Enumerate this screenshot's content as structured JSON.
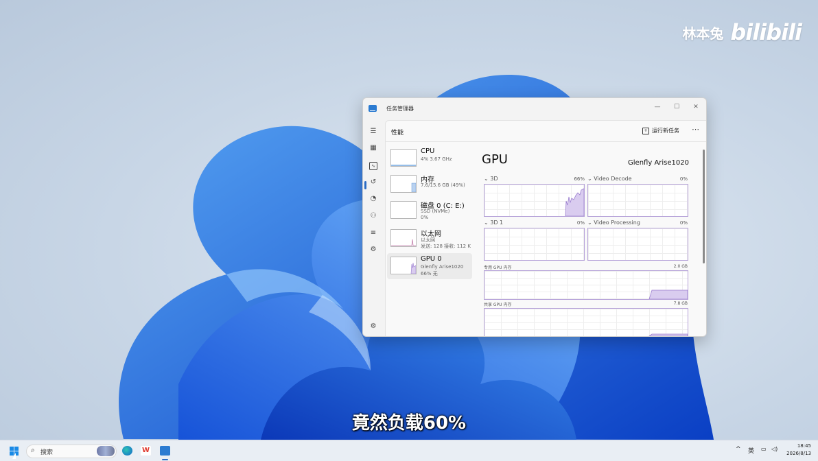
{
  "watermark": {
    "author": "林本兔",
    "brand": "bilibili"
  },
  "subtitle": "竟然负载60%",
  "window": {
    "title": "任务管理器",
    "controls": {
      "minimize": "—",
      "maximize": "☐",
      "close": "✕"
    },
    "page_title": "性能",
    "run_new_task": "运行新任务",
    "more": "⋯"
  },
  "nav_icons": [
    "hamburger-icon",
    "processes-icon",
    "performance-icon",
    "app-history-icon",
    "startup-icon",
    "users-icon",
    "details-icon",
    "services-icon",
    "settings-icon"
  ],
  "devices": [
    {
      "name": "CPU",
      "line1": "4%  3.67 GHz",
      "line2": ""
    },
    {
      "name": "内存",
      "line1": "7.6/15.6 GB (49%)",
      "line2": ""
    },
    {
      "name": "磁盘 0 (C: E:)",
      "line1": "SSD (NVMe)",
      "line2": "0%"
    },
    {
      "name": "以太网",
      "line1": "以太网",
      "line2": "发送: 128  接收: 112 K"
    },
    {
      "name": "GPU 0",
      "line1": "Glenfly Arise1020",
      "line2": "66% 无"
    }
  ],
  "gpu": {
    "title": "GPU",
    "model": "Glenfly Arise1020",
    "engines": [
      {
        "label": "3D",
        "value": "66%"
      },
      {
        "label": "Video Decode",
        "value": "0%"
      },
      {
        "label": "3D 1",
        "value": "0%"
      },
      {
        "label": "Video Processing",
        "value": "0%"
      }
    ],
    "dedicated": {
      "label": "专用 GPU 内存",
      "value": "2.0 GB"
    },
    "shared": {
      "label": "共享 GPU 内存",
      "value": "7.8 GB"
    },
    "chevron": "⌄"
  },
  "taskbar": {
    "search_label": "搜索",
    "wps": "W",
    "tray_caret": "^",
    "ime": "英",
    "time": "18:45",
    "date": "2026/8/13"
  },
  "colors": {
    "accent": "#2b6cc4",
    "gpu_graph": "#b4a0d8",
    "gpu_fill": "#d9ccef"
  }
}
